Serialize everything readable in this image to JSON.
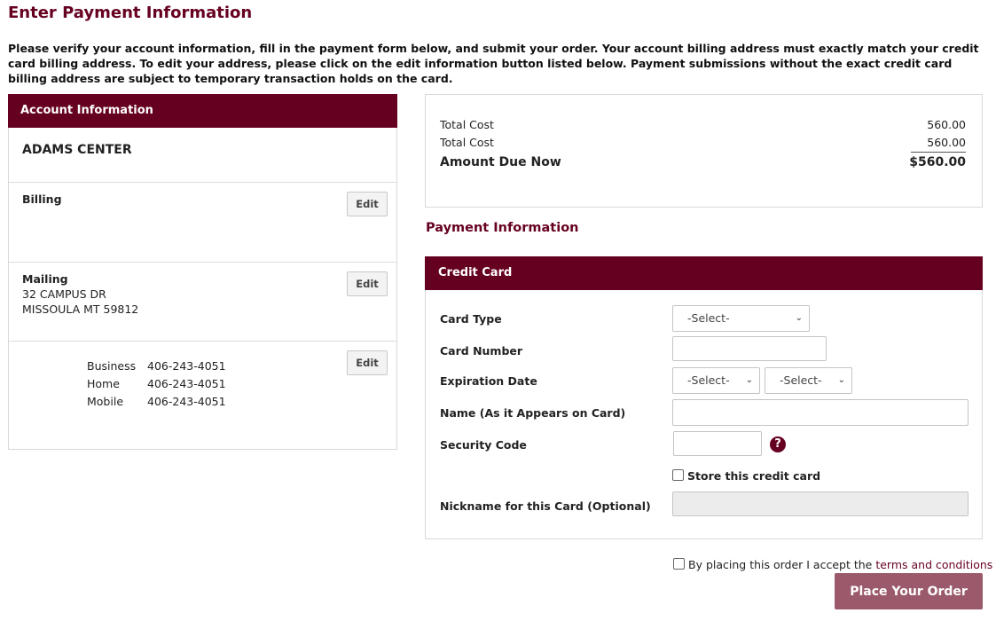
{
  "page": {
    "title": "Enter Payment Information",
    "intro": "Please verify your account information, fill in the payment form below, and submit your order. Your account billing address must exactly match your credit card billing address. To edit your address, please click on the edit information button listed below. Payment submissions without the exact credit card billing address are subject to temporary transaction holds on the card."
  },
  "account": {
    "header": "Account Information",
    "name": "ADAMS CENTER",
    "billing": {
      "label": "Billing",
      "edit": "Edit"
    },
    "mailing": {
      "label": "Mailing",
      "line1": "32 CAMPUS DR",
      "line2": "MISSOULA MT 59812",
      "edit": "Edit"
    },
    "phones": {
      "edit": "Edit",
      "business_label": "Business",
      "business": "406-243-4051",
      "home_label": "Home",
      "home": "406-243-4051",
      "mobile_label": "Mobile",
      "mobile": "406-243-4051"
    }
  },
  "totals": {
    "row1_label": "Total Cost",
    "row1_value": "560.00",
    "row2_label": "Total Cost",
    "row2_value": "560.00",
    "due_label": "Amount Due Now",
    "due_value": "$560.00"
  },
  "payment": {
    "title": "Payment Information",
    "cc_header": "Credit Card",
    "card_type_label": "Card Type",
    "card_type_value": "-Select-",
    "card_number_label": "Card Number",
    "card_number_value": "",
    "expiration_label": "Expiration Date",
    "exp_month_value": "-Select-",
    "exp_year_value": "-Select-",
    "name_label": "Name (As it Appears on Card)",
    "name_value": "",
    "security_label": "Security Code",
    "security_value": "",
    "help_glyph": "?",
    "store_label": "Store this credit card",
    "store_checked": false,
    "nickname_label": "Nickname for this Card (Optional)",
    "nickname_value": ""
  },
  "footer": {
    "terms_prefix": "By placing this order I accept the ",
    "terms_link": "terms and conditions",
    "terms_checked": false,
    "place_order": "Place Your Order"
  },
  "colors": {
    "brand": "#660020",
    "button_muted": "#9b5a6b"
  }
}
